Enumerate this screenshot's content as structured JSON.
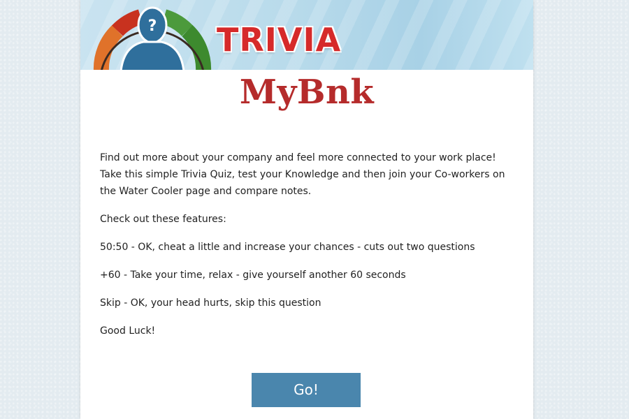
{
  "header": {
    "title": "TRIVIA",
    "logo_icon": "person-question-gauge-icon"
  },
  "brand": {
    "name": "MyBnk"
  },
  "content": {
    "intro": "Find out more about your company and feel more connected to your work place! Take this simple Trivia Quiz, test your Knowledge and then join your Co-workers on the Water Cooler page and compare notes.",
    "features_heading": "Check out these features:",
    "features": [
      "50:50 - OK, cheat a little and increase your chances - cuts out two questions",
      "+60 - Take your time, relax - give yourself another 60 seconds",
      "Skip - OK, your head hurts, skip this question"
    ],
    "closing": "Good Luck!"
  },
  "actions": {
    "go_label": "Go!"
  },
  "colors": {
    "title_red": "#d62a2a",
    "brand_red": "#b52b2b",
    "button_blue": "#4a86ad",
    "header_blue": "#b9dbeb",
    "figure_blue": "#2f6f9c"
  }
}
